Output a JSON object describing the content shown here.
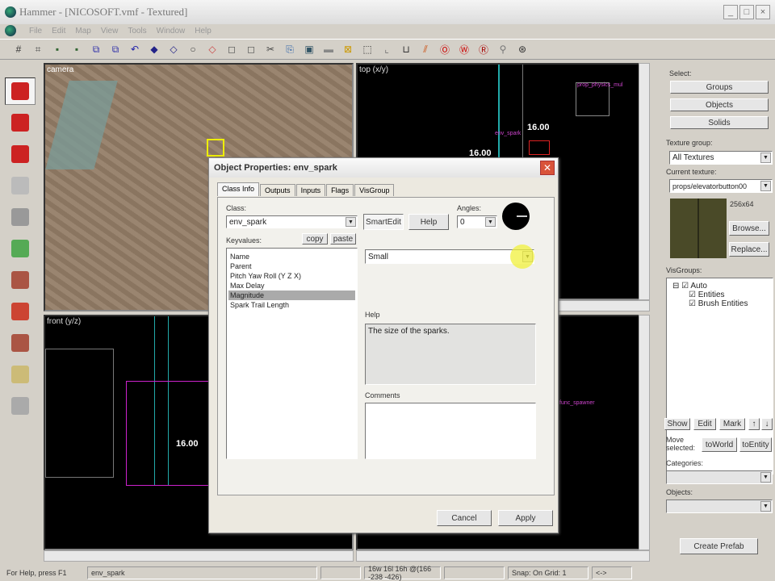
{
  "window": {
    "title": "Hammer - [NICOSOFT.vmf - Textured]",
    "controls": [
      "_",
      "□",
      "×"
    ]
  },
  "menu": [
    "File",
    "Edit",
    "Map",
    "View",
    "Tools",
    "Window",
    "Help"
  ],
  "toolbar_icons": [
    "grid-icon",
    "grid-toggle-icon",
    "3d-grid-icon",
    "3d-grid2-icon",
    "load-window-icon",
    "save-window-icon",
    "undo-icon",
    "group-icon",
    "ungroup-icon",
    "hide-icon",
    "carve-icon",
    "hollow-icon",
    "clip-icon",
    "cut-icon",
    "copy-icon",
    "paste-icon",
    "texture-lock-icon",
    "scale-lock-icon",
    "select-box-icon",
    "handles-icon",
    "texture-icon",
    "decal-icon",
    "run-map-icon",
    "entity-report-icon",
    "check-problems-icon",
    "compile-icon",
    "help-icon"
  ],
  "palette_icons": [
    "selection-tool-icon",
    "magnify-icon",
    "camera-tool-icon",
    "entity-tool-icon",
    "block-tool-icon",
    "texture-application-icon",
    "apply-texture-icon",
    "decal-tool-icon",
    "overlay-tool-icon",
    "clipping-tool-icon",
    "vertex-tool-icon"
  ],
  "viewports": {
    "camera": "camera",
    "top": "top (x/y)",
    "front": "front (y/z)",
    "top_dim1": "16.00",
    "top_dim2": "16.00",
    "top_entity1": "prop_physics_mul",
    "top_entity2": "env_spark",
    "front_dim": "16.00",
    "side_entity": "func_spawner"
  },
  "dialog": {
    "title": "Object Properties: env_spark",
    "tabs": [
      "Class Info",
      "Outputs",
      "Inputs",
      "Flags",
      "VisGroup"
    ],
    "active_tab": "Class Info",
    "class_label": "Class:",
    "class_value": "env_spark",
    "smartedit": "SmartEdit",
    "help_btn": "Help",
    "angles_label": "Angles:",
    "angles_value": "0",
    "keyvalues_label": "Keyvalues:",
    "copy": "copy",
    "paste": "paste",
    "keyvalues": [
      "Name",
      "Parent",
      "Pitch Yaw Roll (Y Z X)",
      "Max Delay",
      "Magnitude",
      "Spark Trail Length"
    ],
    "selected_key": "Magnitude",
    "value_select": "Small",
    "help_label": "Help",
    "help_text": "The size of the sparks.",
    "comments_label": "Comments",
    "comments_value": "",
    "cancel": "Cancel",
    "apply": "Apply"
  },
  "right": {
    "select_label": "Select:",
    "groups": "Groups",
    "objects": "Objects",
    "solids": "Solids",
    "texture_group_label": "Texture group:",
    "texture_group": "All Textures",
    "current_texture_label": "Current texture:",
    "current_texture": "props/elevatorbutton00",
    "texture_size": "256x64",
    "browse": "Browse...",
    "replace": "Replace...",
    "visgroups_label": "VisGroups:",
    "visgroups": [
      {
        "label": "Auto",
        "checked": true
      },
      {
        "label": "Entities",
        "checked": true
      },
      {
        "label": "Brush Entities",
        "checked": true
      }
    ],
    "show": "Show",
    "edit": "Edit",
    "mark": "Mark",
    "up": "↑",
    "down": "↓",
    "move_selected": "Move selected:",
    "toworld": "toWorld",
    "toentity": "toEntity",
    "categories_label": "Categories:",
    "objects_label": "Objects:",
    "create_prefab": "Create Prefab"
  },
  "status": {
    "help": "For Help, press F1",
    "selection": "env_spark",
    "blank": "",
    "size": "16w 16l 16h @(166 -238 -426)",
    "blank2": "",
    "snap": "Snap: On Grid: 1",
    "arrows": "<->"
  }
}
